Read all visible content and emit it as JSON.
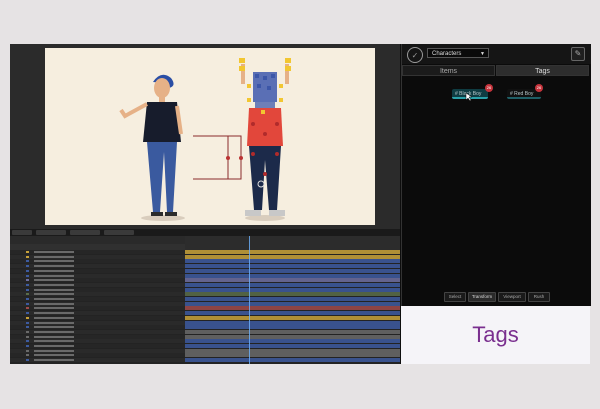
{
  "panel": {
    "dropdown_value": "Characters",
    "tabs": [
      {
        "label": "Items"
      },
      {
        "label": "Tags"
      }
    ],
    "active_tab": "Tags",
    "tags": [
      {
        "label": "# Black Boy",
        "count": "26"
      },
      {
        "label": "# Red Boy",
        "count": "26"
      }
    ],
    "bottom_tabs": [
      {
        "label": "Select"
      },
      {
        "label": "Transform"
      },
      {
        "label": "Viewport"
      },
      {
        "label": "Rush"
      }
    ],
    "colors": {
      "accent": "#1f5f66",
      "badge": "#c5333b"
    }
  },
  "caption": {
    "text": "Tags"
  },
  "icons": {
    "logo": "app-logo-icon",
    "settings": "tag-settings-icon"
  }
}
